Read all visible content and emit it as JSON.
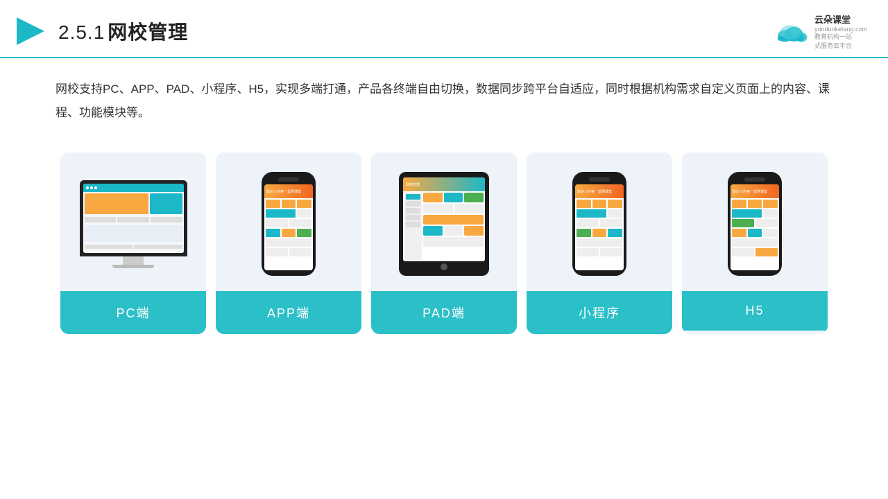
{
  "header": {
    "title": "2.5.1网校管理",
    "title_num": "2.5.1",
    "title_text": "网校管理"
  },
  "logo": {
    "name": "云朵课堂",
    "url": "yunduoketang.com",
    "slogan_line1": "教育机构一站",
    "slogan_line2": "式服务云平台"
  },
  "description": "网校支持PC、APP、PAD、小程序、H5，实现多端打通，产品各终端自由切换，数据同步跨平台自适应，同时根据机构需求自定义页面上的内容、课程、功能模块等。",
  "cards": [
    {
      "id": "pc",
      "label": "PC端",
      "type": "pc"
    },
    {
      "id": "app",
      "label": "APP端",
      "type": "phone"
    },
    {
      "id": "pad",
      "label": "PAD端",
      "type": "tablet"
    },
    {
      "id": "miniapp",
      "label": "小程序",
      "type": "phone"
    },
    {
      "id": "h5",
      "label": "H5",
      "type": "phone"
    }
  ],
  "colors": {
    "accent": "#2bbfc8",
    "orange": "#f8a840",
    "border": "#1db8c8"
  }
}
